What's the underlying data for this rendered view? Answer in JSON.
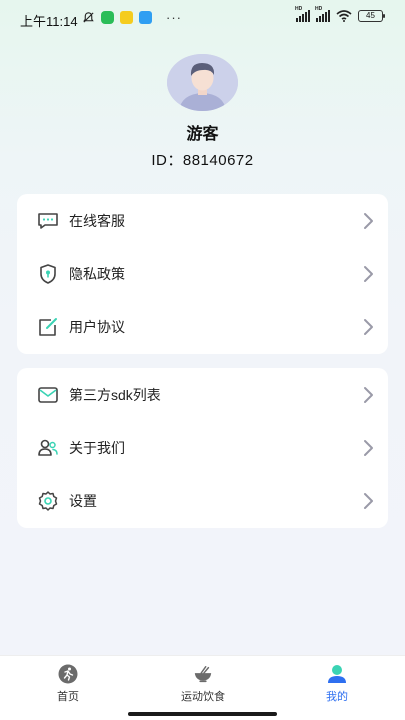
{
  "status_bar": {
    "time": "上午11:14",
    "icon_labels": [
      "wechat",
      "yellow-app",
      "blue-app"
    ],
    "dots": "···",
    "signal_label": "HD",
    "battery": "45"
  },
  "profile": {
    "username": "游客",
    "id_text": "ID：88140672"
  },
  "menu_group_1": [
    {
      "label": "在线客服",
      "icon": "chat-bubble-icon"
    },
    {
      "label": "隐私政策",
      "icon": "shield-icon"
    },
    {
      "label": "用户协议",
      "icon": "edit-document-icon"
    }
  ],
  "menu_group_2": [
    {
      "label": "第三方sdk列表",
      "icon": "envelope-icon"
    },
    {
      "label": "关于我们",
      "icon": "users-icon"
    },
    {
      "label": "设置",
      "icon": "gear-icon"
    }
  ],
  "tabs": [
    {
      "label": "首页",
      "icon": "runner-icon",
      "active": false
    },
    {
      "label": "运动饮食",
      "icon": "bowl-icon",
      "active": false
    },
    {
      "label": "我的",
      "icon": "person-icon",
      "active": true
    }
  ],
  "colors": {
    "accent_blue": "#2e6ff0",
    "accent_teal": "#3ad3b4",
    "icon_gray": "#4a4a4a"
  }
}
